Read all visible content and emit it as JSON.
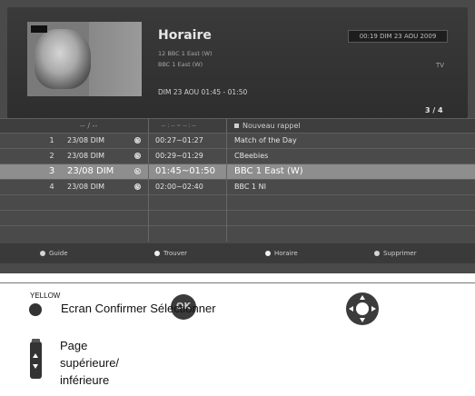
{
  "header": {
    "title": "Horaire",
    "clock": "00:19 DIM 23 AOU 2009",
    "channel_line1": "12 BBC 1 East (W)",
    "channel_line2": "BBC 1 East (W)",
    "tv_label": "TV",
    "datetime": "DIM 23 AOU 01:45 - 01:50",
    "page": "3 / 4"
  },
  "table": {
    "header": {
      "date": "-- / --",
      "time": "-- : -- ~ -- : --",
      "program": "Nouveau rappel"
    },
    "rows": [
      {
        "num": "1",
        "date": "23/08 DIM",
        "time": "00:27~01:27",
        "program": "Match of the Day"
      },
      {
        "num": "2",
        "date": "23/08 DIM",
        "time": "00:29~01:29",
        "program": "CBeebies"
      },
      {
        "num": "3",
        "date": "23/08 DIM",
        "time": "01:45~01:50",
        "program": "BBC 1 East (W)"
      },
      {
        "num": "4",
        "date": "23/08 DIM",
        "time": "02:00~02:40",
        "program": "BBC 1 NI"
      }
    ]
  },
  "footer": {
    "guide": "Guide",
    "trouver": "Trouver",
    "horaire": "Horaire",
    "supprimer": "Supprimer"
  },
  "legend": {
    "yellow_label": "YELLOW",
    "ok_label": "OK",
    "ecran_text": "Ecran Confirmer Sélectionner",
    "page_line1": "Page",
    "page_line2": "supérieure/",
    "page_line3": "inférieure"
  }
}
